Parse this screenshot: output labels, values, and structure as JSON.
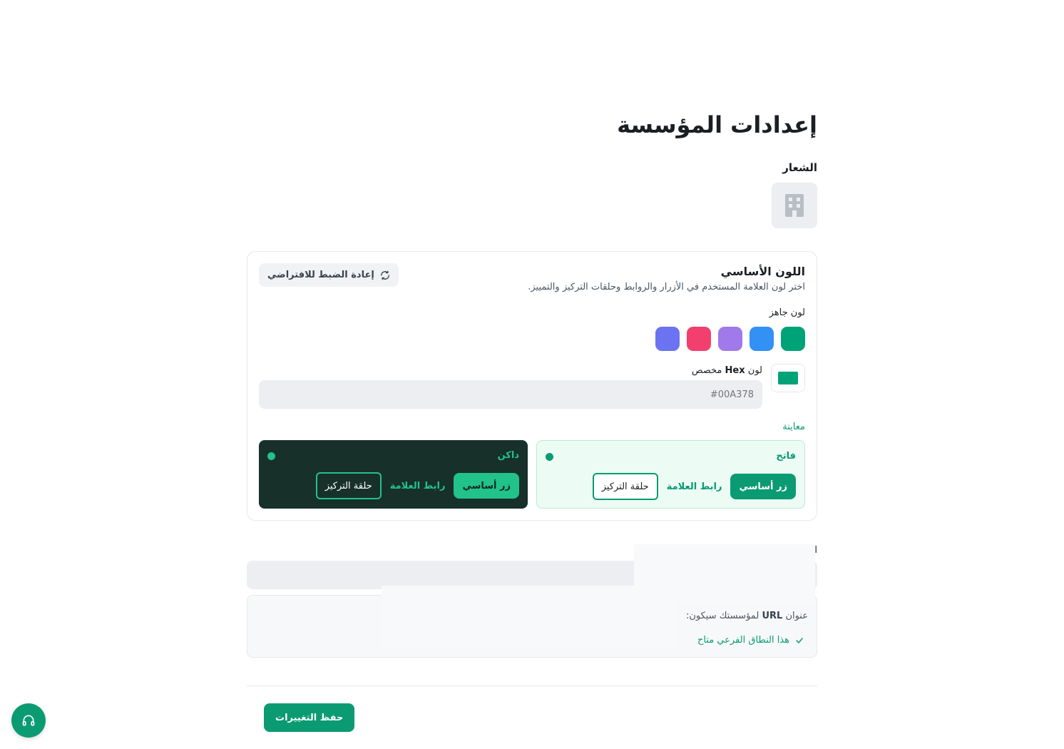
{
  "page": {
    "title": "إعدادات المؤسسة"
  },
  "logo": {
    "label": "الشعار",
    "icon": "building-icon"
  },
  "primary_color": {
    "title": "اللون الأساسي",
    "description": "اختر لون العلامة المستخدم في الأزرار والروابط وحلقات التركيز والتمييز.",
    "reset_label": "إعادة الضبط للافتراضي",
    "preset_label": "لون جاهز",
    "presets": [
      "#00A378",
      "#3390F5",
      "#A07AEA",
      "#F23F6D",
      "#6B73F2"
    ],
    "custom_label_prefix": "لون",
    "custom_label_code": "Hex",
    "custom_label_suffix": "مخصص",
    "hex_placeholder": "#00A378",
    "selected": "#00A378",
    "preview_label": "معاينة",
    "preview_light": {
      "title": "فاتح",
      "button": "زر أساسي",
      "link": "رابط العلامة",
      "ring": "حلقة التركيز"
    },
    "preview_dark": {
      "title": "داكن",
      "button": "زر أساسي",
      "link": "رابط العلامة",
      "ring": "حلقة التركيز"
    }
  },
  "subdomain": {
    "label": "ا",
    "url_prefix": "عنوان",
    "url_code": "URL",
    "url_suffix": "لمؤسستك سيكون:",
    "available": "هذا النطاق الفرعي متاح"
  },
  "actions": {
    "save": "حفظ التغييرات"
  },
  "help": {
    "icon": "headset-icon"
  }
}
